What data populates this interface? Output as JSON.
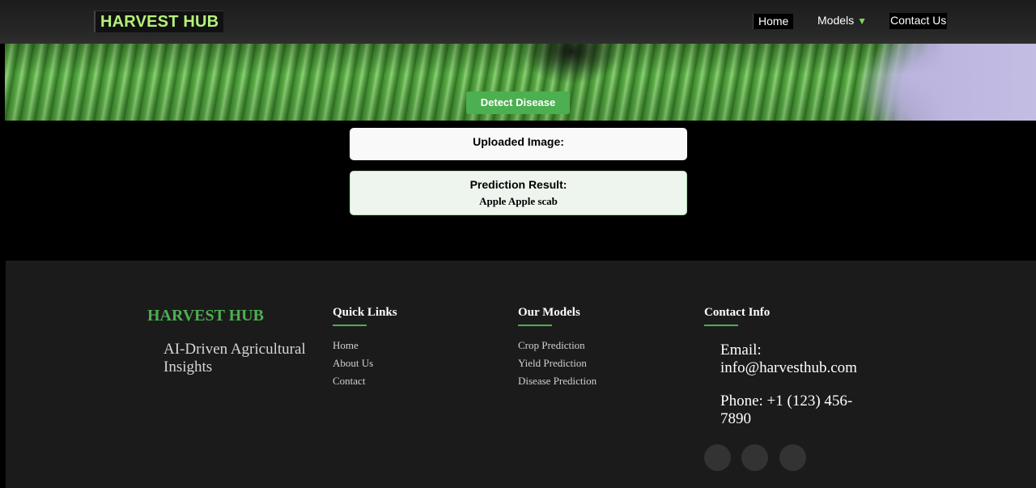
{
  "header": {
    "logo": "HARVEST HUB",
    "nav": {
      "home": "Home",
      "models": "Models",
      "models_caret": "▼",
      "contact": "Contact Us"
    }
  },
  "hero": {
    "detect_button": "Detect Disease"
  },
  "results": {
    "uploaded_title": "Uploaded Image:",
    "prediction_title": "Prediction Result:",
    "prediction_value": "Apple Apple scab"
  },
  "footer": {
    "brand": "HARVEST HUB",
    "tagline": "AI-Driven Agricultural Insights",
    "quick_links": {
      "title": "Quick Links",
      "items": [
        "Home",
        "About Us",
        "Contact"
      ]
    },
    "our_models": {
      "title": "Our Models",
      "items": [
        "Crop Prediction",
        "Yield Prediction",
        "Disease Prediction"
      ]
    },
    "contact_info": {
      "title": "Contact Info",
      "email": "Email: info@harvesthub.com",
      "phone": "Phone: +1 (123) 456-7890"
    },
    "social_icons": [
      "social-icon",
      "social-icon",
      "social-icon"
    ]
  },
  "colors": {
    "accent_green": "#4caf50",
    "logo_green": "#b5f07a",
    "footer_bg": "#1b1b1b",
    "page_bg": "#000000"
  }
}
